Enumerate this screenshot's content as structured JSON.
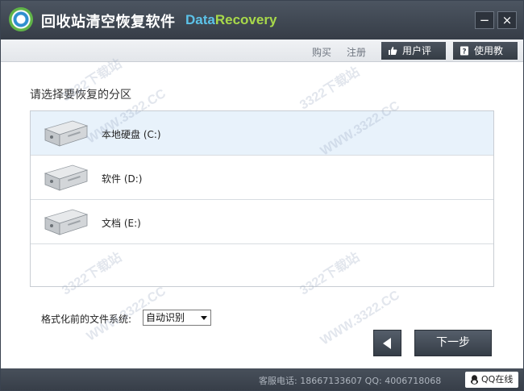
{
  "window": {
    "title_cn": "回收站清空恢复软件",
    "title_en_part1": "Data",
    "title_en_part2": "Recovery",
    "minimize_symbol": "−",
    "close_symbol": "×"
  },
  "toolbar": {
    "buy_label": "购买",
    "register_label": "注册",
    "review_label": "用户评价",
    "guide_label": "使用教程"
  },
  "main": {
    "section_title": "请选择要恢复的分区",
    "drives": [
      {
        "label": "本地硬盘 (C:)",
        "selected": true
      },
      {
        "label": "软件 (D:)",
        "selected": false
      },
      {
        "label": "文档 (E:)",
        "selected": false
      }
    ],
    "fs_label": "格式化前的文件系统:",
    "fs_value": "自动识别",
    "next_label": "下一步"
  },
  "statusbar": {
    "contact": "客服电话: 18667133607 QQ: 4006718068",
    "qq_label": "QQ在线"
  },
  "watermark": {
    "text_domain": "WWW.3322.CC",
    "text_site": "3322下载站"
  },
  "colors": {
    "titlebar": "#3f4752",
    "accent_blue": "#5cc2e8",
    "accent_green": "#a8d94a",
    "selected_row": "#e8f2fb"
  }
}
